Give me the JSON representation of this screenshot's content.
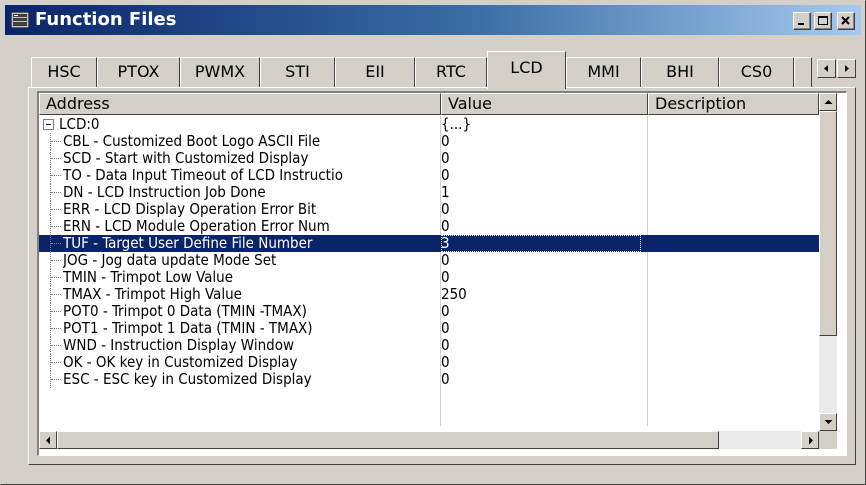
{
  "window": {
    "title": "Function Files"
  },
  "title_buttons": [
    "minimize",
    "maximize",
    "close"
  ],
  "tabs": [
    {
      "label": "HSC",
      "active": false
    },
    {
      "label": "PTOX",
      "active": false
    },
    {
      "label": "PWMX",
      "active": false
    },
    {
      "label": "STI",
      "active": false
    },
    {
      "label": "EII",
      "active": false
    },
    {
      "label": "RTC",
      "active": false
    },
    {
      "label": "LCD",
      "active": true
    },
    {
      "label": "MMI",
      "active": false
    },
    {
      "label": "BHI",
      "active": false
    },
    {
      "label": "CS0",
      "active": false
    }
  ],
  "table": {
    "columns": [
      "Address",
      "Value",
      "Description"
    ],
    "rows": [
      {
        "address": "LCD:0",
        "value": "{...}",
        "description": "",
        "root": true
      },
      {
        "address": "CBL - Customized Boot Logo ASCII File",
        "value": "0",
        "description": ""
      },
      {
        "address": "SCD - Start with Customized Display",
        "value": "0",
        "description": ""
      },
      {
        "address": "TO - Data Input Timeout of LCD Instructio",
        "value": "0",
        "description": ""
      },
      {
        "address": "DN - LCD Instruction Job Done",
        "value": "1",
        "description": ""
      },
      {
        "address": "ERR - LCD Display Operation Error Bit",
        "value": "0",
        "description": ""
      },
      {
        "address": "ERN - LCD Module Operation Error Num",
        "value": "0",
        "description": ""
      },
      {
        "address": "TUF - Target User Define File Number",
        "value": "3",
        "description": "",
        "selected": true
      },
      {
        "address": "JOG - Jog data update Mode Set",
        "value": "0",
        "description": ""
      },
      {
        "address": "TMIN - Trimpot Low Value",
        "value": "0",
        "description": ""
      },
      {
        "address": "TMAX - Trimpot High Value",
        "value": "250",
        "description": ""
      },
      {
        "address": "POT0 - Trimpot 0 Data (TMIN -TMAX)",
        "value": "0",
        "description": ""
      },
      {
        "address": "POT1 - Trimpot 1 Data (TMIN - TMAX)",
        "value": "0",
        "description": ""
      },
      {
        "address": "WND - Instruction Display Window",
        "value": "0",
        "description": ""
      },
      {
        "address": "OK - OK key in Customized Display",
        "value": "0",
        "description": ""
      },
      {
        "address": "ESC - ESC key in Customized Display",
        "value": "0",
        "description": ""
      }
    ]
  },
  "colors": {
    "selection": "#0a246a",
    "title_gradient_start": "#0a246a",
    "title_gradient_end": "#a6caf0",
    "face": "#d4d0c8"
  }
}
